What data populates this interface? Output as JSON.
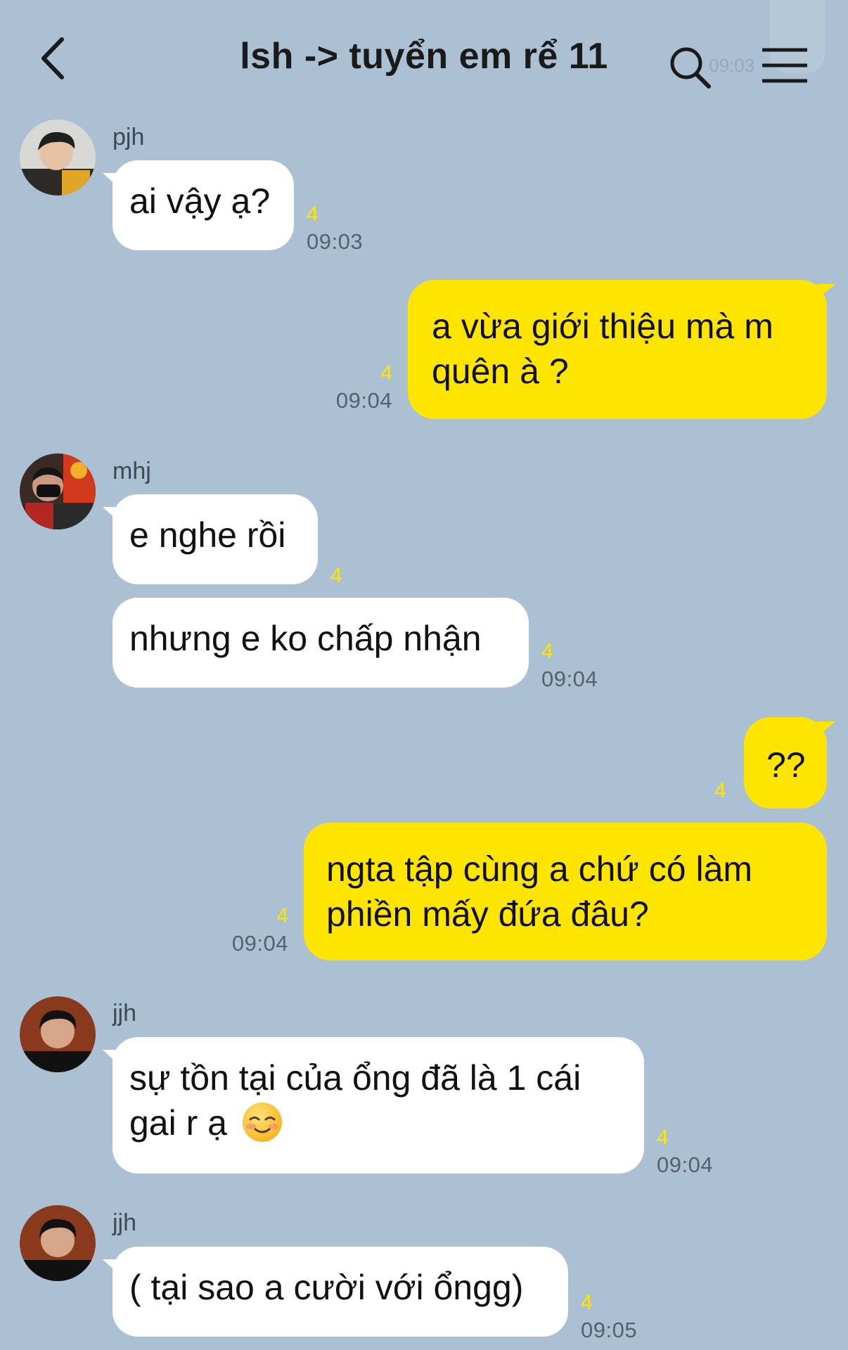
{
  "header": {
    "title": "lsh -> tuyển em rể 11",
    "ghost_time": "09:03",
    "back_icon": "chevron-left-icon",
    "search_icon": "search-icon",
    "menu_icon": "hamburger-menu-icon"
  },
  "colors": {
    "background": "#abc1d3",
    "incoming_bubble": "#ffffff",
    "outgoing_bubble": "#fee500",
    "unread_count": "#ffe600"
  },
  "messages": [
    {
      "sender": "pjh",
      "text": "ai vậy ạ?",
      "unread": "4",
      "time": "09:03",
      "direction": "incoming"
    },
    {
      "text_lines": [
        "a vừa giới thiệu mà m",
        "quên à ?"
      ],
      "unread": "4",
      "time": "09:04",
      "direction": "outgoing"
    },
    {
      "sender": "mhj",
      "text": "e nghe rồi",
      "unread": "4",
      "direction": "incoming"
    },
    {
      "text": "nhưng e ko chấp nhận",
      "unread": "4",
      "time": "09:04",
      "direction": "incoming"
    },
    {
      "text": "??",
      "unread": "4",
      "direction": "outgoing"
    },
    {
      "text_lines": [
        "ngta tập cùng a chứ có làm",
        "phiền mấy đứa đâu?"
      ],
      "unread": "4",
      "time": "09:04",
      "direction": "outgoing"
    },
    {
      "sender": "jjh",
      "text_lines": [
        "sự tồn tại của ổng đã là 1 cái",
        "gai r ạ"
      ],
      "emoji": "smiling-face-emoji",
      "unread": "4",
      "time": "09:04",
      "direction": "incoming"
    },
    {
      "sender": "jjh",
      "text": "( tại sao a cười với ổngg)",
      "unread": "4",
      "time": "09:05",
      "direction": "incoming"
    }
  ]
}
